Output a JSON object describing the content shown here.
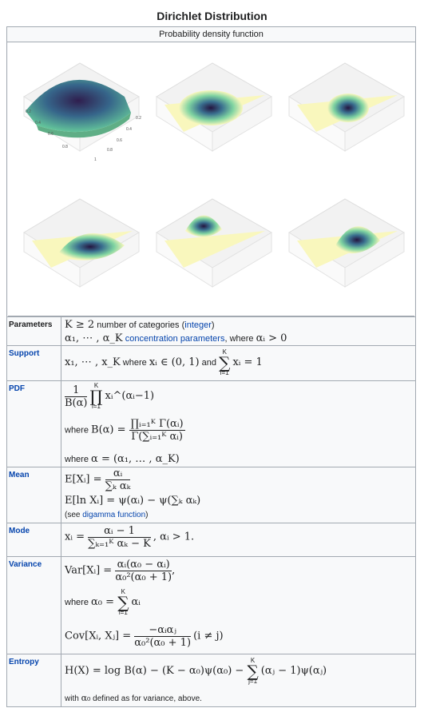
{
  "title": "Dirichlet Distribution",
  "caption": "Probability density function",
  "axis_ticks": {
    "left": [
      "0.2",
      "0.4",
      "0.6",
      "0.8"
    ],
    "right": [
      "0.2",
      "0.4",
      "0.6",
      "0.8"
    ],
    "bottom": "1",
    "left_axis_var": "x",
    "right_axis_var": "y"
  },
  "colors": {
    "border": "#a2a9b1",
    "link": "#0645ad",
    "surface_dark": "#2f1e4e",
    "surface_mid": "#3a8a8e",
    "surface_light": "#f9f7bd"
  },
  "rows": {
    "parameters": {
      "label": "Parameters",
      "line1_math": "K ≥ 2",
      "line1_text": " number of categories (",
      "line1_link": "integer",
      "line1_close": ")",
      "line2_math": "α₁, ⋯ , α_K",
      "line2_link": "concentration parameters",
      "line2_text": ", where ",
      "line2_math2": "αᵢ > 0"
    },
    "support": {
      "label": "Support",
      "math1": "x₁, ⋯ , x_K",
      "text": " where ",
      "math2": "xᵢ ∈ (0, 1)",
      "and": " and ",
      "sum_top": "K",
      "sum_bottom": "i=1",
      "math3": "xᵢ = 1"
    },
    "pdf": {
      "label": "PDF",
      "frac_num": "1",
      "frac_den": "B(α)",
      "prod_top": "K",
      "prod_bottom": "i=1",
      "term": "xᵢ^(αᵢ−1)",
      "where1": "where ",
      "beta_lhs": "B(α) = ",
      "beta_num": "∏ᵢ₌₁ᴷ Γ(αᵢ)",
      "beta_den": "Γ(∑ᵢ₌₁ᴷ αᵢ)",
      "where2": "where ",
      "alpha_def": "α = (α₁, … , α_K)"
    },
    "mean": {
      "label": "Mean",
      "lhs1": "E[Xᵢ] = ",
      "num1": "αᵢ",
      "den1": "∑ₖ αₖ",
      "line2": "E[ln Xᵢ] = ψ(αᵢ) − ψ(∑ₖ αₖ)",
      "see": "(see ",
      "see_link": "digamma function",
      "see_close": ")"
    },
    "mode": {
      "label": "Mode",
      "lhs": "xᵢ = ",
      "num": "αᵢ − 1",
      "den": "∑ₖ₌₁ᴷ αₖ − K",
      "rhs": ",    αᵢ > 1."
    },
    "variance": {
      "label": "Variance",
      "lhs1": "Var[Xᵢ] = ",
      "num1": "αᵢ(α₀ − αᵢ)",
      "den1": "α₀²(α₀ + 1)",
      "comma": ",",
      "where": "where ",
      "a0": "α₀ = ",
      "sum_top": "K",
      "sum_bottom": "i=1",
      "a0_term": "αᵢ",
      "lhs2": "Cov[Xᵢ, Xⱼ] = ",
      "num2": "−αᵢαⱼ",
      "den2": "α₀²(α₀ + 1)",
      "cond": "  (i ≠ j)"
    },
    "entropy": {
      "label": "Entropy",
      "lhs": "H(X) = log B(α) − (K − α₀)ψ(α₀) − ",
      "sum_top": "K",
      "sum_bottom": "j=1",
      "rhs": "(αⱼ − 1)ψ(αⱼ)",
      "note_pre": "with ",
      "note_math": "α₀",
      "note_post": " defined as for variance, above."
    }
  }
}
